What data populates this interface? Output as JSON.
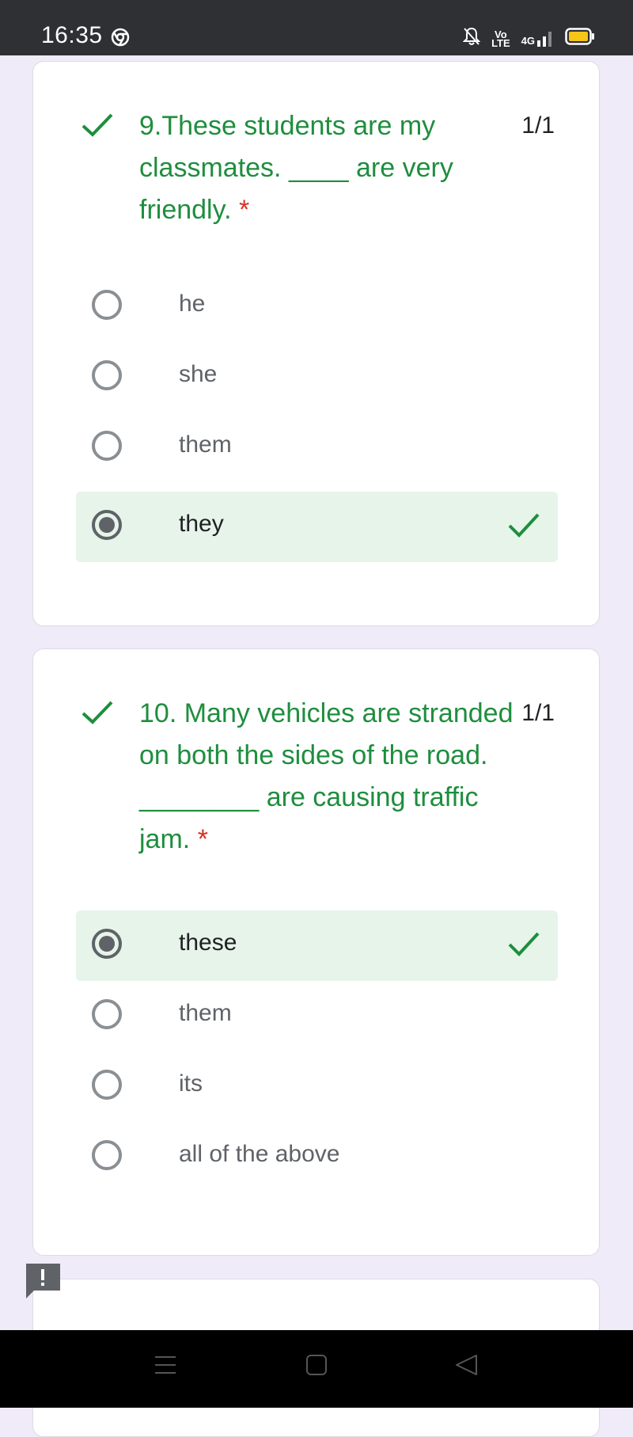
{
  "status_bar": {
    "time": "16:35",
    "icons": [
      "chrome-icon",
      "bell-off-icon",
      "volte-icon",
      "4g-signal-icon",
      "battery-icon"
    ],
    "network_top": "Vo",
    "network_bottom": "LTE",
    "network_type": "4G",
    "battery_color": "#f5c518"
  },
  "questions": [
    {
      "status": "correct",
      "text": "9.These students are my classmates. ____ are very friendly.",
      "required_mark": "*",
      "score": "1/1",
      "options": [
        {
          "label": "he",
          "selected": false,
          "correct": false
        },
        {
          "label": "she",
          "selected": false,
          "correct": false
        },
        {
          "label": "them",
          "selected": false,
          "correct": false
        },
        {
          "label": "they",
          "selected": true,
          "correct": true
        }
      ]
    },
    {
      "status": "correct",
      "text": "10. Many vehicles are stranded on both the sides of the road. ________ are causing traffic jam.",
      "required_mark": "*",
      "score": "1/1",
      "options": [
        {
          "label": "these",
          "selected": true,
          "correct": true
        },
        {
          "label": "them",
          "selected": false,
          "correct": false
        },
        {
          "label": "its",
          "selected": false,
          "correct": false
        },
        {
          "label": "all of the above",
          "selected": false,
          "correct": false
        }
      ]
    }
  ],
  "colors": {
    "correct_green": "#1e8e3e",
    "correct_bg": "#e6f4ea",
    "required_red": "#d93025",
    "page_bg": "#efebf8"
  },
  "nav_bar": {
    "icons": [
      "menu-icon",
      "home-icon",
      "back-icon"
    ]
  }
}
